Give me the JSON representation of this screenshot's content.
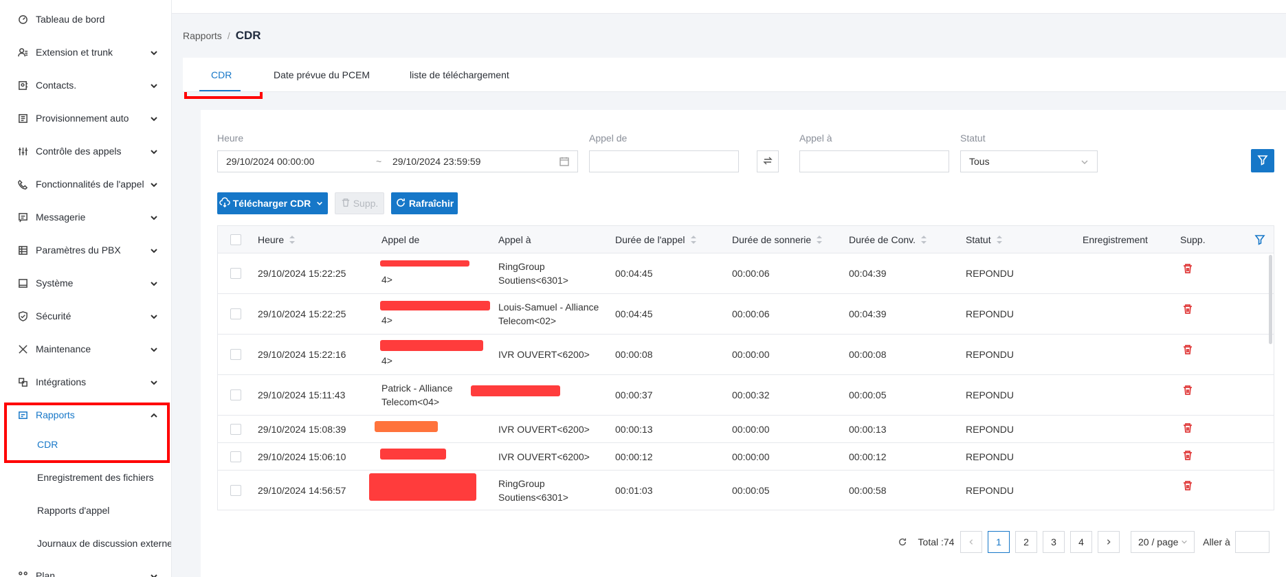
{
  "sidebar": {
    "items": [
      {
        "label": "Tableau de bord",
        "icon": "dashboard-icon"
      },
      {
        "label": "Extension et trunk",
        "icon": "users-icon"
      },
      {
        "label": "Contacts.",
        "icon": "contacts-icon"
      },
      {
        "label": "Provisionnement auto",
        "icon": "provisioning-icon"
      },
      {
        "label": "Contrôle des appels",
        "icon": "call-control-icon"
      },
      {
        "label": "Fonctionnalités de l'appel",
        "icon": "phone-icon"
      },
      {
        "label": "Messagerie",
        "icon": "message-icon"
      },
      {
        "label": "Paramètres du PBX",
        "icon": "pbx-settings-icon"
      },
      {
        "label": "Système",
        "icon": "system-icon"
      },
      {
        "label": "Sécurité",
        "icon": "shield-icon"
      },
      {
        "label": "Maintenance",
        "icon": "tools-icon"
      },
      {
        "label": "Intégrations",
        "icon": "integrations-icon"
      },
      {
        "label": "Rapports",
        "icon": "reports-icon"
      }
    ],
    "sub_items": [
      "CDR",
      "Enregistrement des fichiers",
      "Rapports d'appel",
      "Journaux de discussion externe"
    ],
    "partial_item": "Plan"
  },
  "breadcrumb": {
    "parent": "Rapports",
    "separator": "/",
    "current": "CDR"
  },
  "tabs": [
    "CDR",
    "Date prévue du PCEM",
    "liste de téléchargement"
  ],
  "filters": {
    "heure_label": "Heure",
    "date_start": "29/10/2024 00:00:00",
    "date_sep": "~",
    "date_end": "29/10/2024 23:59:59",
    "appel_de_label": "Appel de",
    "appel_a_label": "Appel à",
    "statut_label": "Statut",
    "statut_value": "Tous"
  },
  "actions": {
    "download": "Télécharger CDR",
    "delete": "Supp.",
    "refresh": "Rafraîchir"
  },
  "table": {
    "headers": [
      "Heure",
      "Appel de",
      "Appel à",
      "Durée de l'appel",
      "Durée de sonnerie",
      "Durée de Conv.",
      "Statut",
      "Enregistrement",
      "Supp."
    ],
    "rows": [
      {
        "heure": "29/10/2024 15:22:25",
        "de": "4>",
        "a1": "RingGroup",
        "a2": "Soutiens<6301>",
        "duree": "00:04:45",
        "sonnerie": "00:00:06",
        "conv": "00:04:39",
        "statut": "REPONDU"
      },
      {
        "heure": "29/10/2024 15:22:25",
        "de": "4>",
        "a1": "Louis-Samuel - Alliance",
        "a2": "Telecom<02>",
        "duree": "00:04:45",
        "sonnerie": "00:00:06",
        "conv": "00:04:39",
        "statut": "REPONDU"
      },
      {
        "heure": "29/10/2024 15:22:16",
        "de": "4>",
        "a1": "IVR OUVERT<6200>",
        "a2": "",
        "duree": "00:00:08",
        "sonnerie": "00:00:00",
        "conv": "00:00:08",
        "statut": "REPONDU"
      },
      {
        "heure": "29/10/2024 15:11:43",
        "de": "Patrick - Alliance",
        "de2": "Telecom<04>",
        "a1": "",
        "a2": "",
        "duree": "00:00:37",
        "sonnerie": "00:00:32",
        "conv": "00:00:05",
        "statut": "REPONDU"
      },
      {
        "heure": "29/10/2024 15:08:39",
        "de": "",
        "a1": "IVR OUVERT<6200>",
        "a2": "",
        "duree": "00:00:13",
        "sonnerie": "00:00:00",
        "conv": "00:00:13",
        "statut": "REPONDU"
      },
      {
        "heure": "29/10/2024 15:06:10",
        "de": "",
        "a1": "IVR OUVERT<6200>",
        "a2": "",
        "duree": "00:00:12",
        "sonnerie": "00:00:00",
        "conv": "00:00:12",
        "statut": "REPONDU"
      },
      {
        "heure": "29/10/2024 14:56:57",
        "de": "",
        "a1": "RingGroup",
        "a2": "Soutiens<6301>",
        "duree": "00:01:03",
        "sonnerie": "00:00:05",
        "conv": "00:00:58",
        "statut": "REPONDU"
      }
    ]
  },
  "pagination": {
    "total": "Total :74",
    "pages": [
      "1",
      "2",
      "3",
      "4"
    ],
    "current_page": "1",
    "per_page": "20 / page",
    "goto_label": "Aller à"
  },
  "colors": {
    "accent": "#1677c8",
    "danger": "#e03b3b",
    "highlight_box": "#ff0000"
  }
}
